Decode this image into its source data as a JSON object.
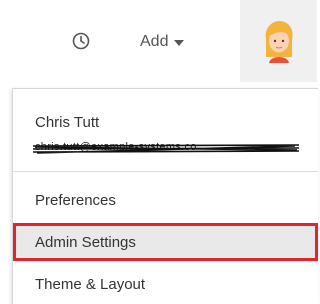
{
  "topbar": {
    "history_icon": "clock-icon",
    "add_label": "Add",
    "add_caret_icon": "caret-down-icon",
    "avatar_icon": "user-avatar"
  },
  "user_menu": {
    "user_name": "Chris Tutt",
    "user_email": "chris.tutt@example-systems.co",
    "items": [
      {
        "label": "Preferences",
        "highlighted": false
      },
      {
        "label": "Admin Settings",
        "highlighted": true
      },
      {
        "label": "Theme & Layout",
        "highlighted": false
      }
    ]
  },
  "colors": {
    "highlight_border": "#e0262b",
    "highlight_bg": "#e9e9e9",
    "avatar_bg": "#f0f0f0",
    "text": "#333333"
  }
}
